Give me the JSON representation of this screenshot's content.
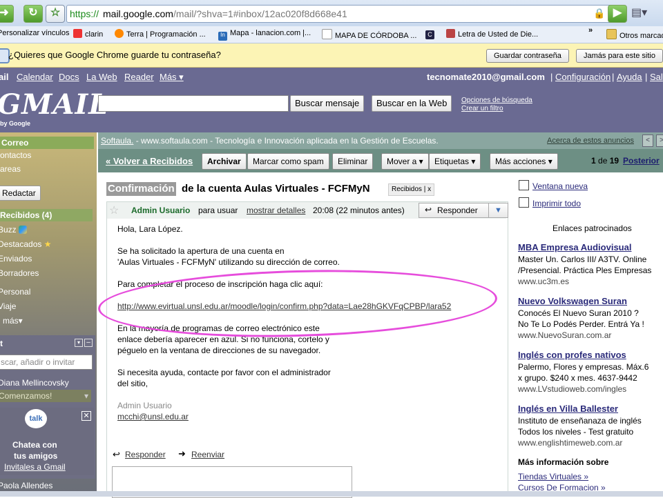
{
  "browser": {
    "url_scheme": "https://",
    "url_host": "mail.google.com",
    "url_path": "/mail/?shva=1#inbox/12ac020f8d668e41",
    "bookmarks": [
      {
        "label": "Personalizar vínculos"
      },
      {
        "label": "clarin"
      },
      {
        "label": "Terra | Programación ..."
      },
      {
        "label": "Mapa - lanacion.com |..."
      },
      {
        "label": "MAPA DE CÓRDOBA ..."
      },
      {
        "label": ""
      },
      {
        "label": "Letra de Usted de Die..."
      },
      {
        "label": "»"
      },
      {
        "label": "Otros marcad"
      }
    ],
    "infobar_text": "¿Quieres que Google Chrome guarde tu contraseña?",
    "infobar_save": "Guardar contraseña",
    "infobar_never": "Jamás para este sitio",
    "colors": {
      "url_green": "#1a8a1a",
      "infobar_bg": "#fcf4b5"
    }
  },
  "gmail": {
    "top_links": [
      "ail",
      "Calendar",
      "Docs",
      "La Web",
      "Reader",
      "Más ▾"
    ],
    "user_email": "tecnomate2010@gmail.com",
    "user_links": [
      "Configuración",
      "Ayuda",
      "Sal"
    ],
    "logo": "GMAIL",
    "logo_sub": "by Google",
    "search_btn": "Buscar mensaje",
    "web_btn": "Buscar en la Web",
    "search_opts_1": "Opciones de búsqueda",
    "search_opts_2": "Crear un filtro"
  },
  "sidebar": {
    "correo": "Correo",
    "contactos": "ontactos",
    "tareas": "areas",
    "redactar": "Redactar",
    "recibidos": "Recibidos (4)",
    "items": [
      "Buzz",
      "Destacados",
      "Enviados",
      "Borradores",
      "Personal",
      "Viaje",
      "más▾"
    ],
    "chat_title": "t",
    "chat_placeholder": "scar, añadir o invitar",
    "contact_1": "Diana Mellincovsky",
    "status": "Comenzamos!",
    "talk_logo": "talk",
    "chatea": "Chatea con",
    "tus_amigos": "tus amigos",
    "invitales": "Invitales a Gmail",
    "contact_2": "Paola Allendes"
  },
  "adbar": {
    "sponsor": "Softaula.",
    "text": " - www.softaula.com - Tecnología e Innovación aplicada en la Gestión de Escuelas.",
    "about": "Acerca de estos anuncios"
  },
  "actions": {
    "back": "« Volver a Recibidos",
    "archive": "Archivar",
    "spam": "Marcar como spam",
    "delete": "Eliminar",
    "move": "Mover a ▾",
    "labels": "Etiquetas ▾",
    "more": "Más acciones ▾",
    "pager_pre": "1",
    "pager_mid": " de ",
    "pager_total": "19",
    "next": "Posterior"
  },
  "message": {
    "subject_hl": "Confirmación",
    "subject_rest": " de la cuenta Aulas Virtuales - FCFMyN",
    "label": "Recibidos",
    "label_x": "x",
    "sender": "Admin Usuario",
    "to": "para usuar",
    "details": "mostrar detalles",
    "time": "20:08 (22 minutos antes)",
    "reply": "Responder",
    "body": [
      "Hola, Lara López.",
      "Se ha solicitado la apertura de una cuenta en",
      "'Aulas Virtuales - FCFMyN' utilizando su dirección de correo.",
      "Para completar el proceso de inscripción haga clic aquí:",
      "http://www.evirtual.unsl.edu.ar/moodle/login/confirm.php?data=Lae28hGKVFqCPBP/lara52",
      "En la mayoría de programas de correo electrónico este",
      "enlace debería aparecer en azul. Si no funciona, cortelo y",
      "péguelo en la ventana de direcciones de su navegador.",
      "Si necesita ayuda, contacte por favor con el administrador",
      "del sitio,",
      "Admin Usuario",
      "mcchi@unsl.edu.ar"
    ],
    "reply_link": "Responder",
    "forward_link": "Reenviar"
  },
  "right": {
    "new_window": "Ventana nueva",
    "print_all": "Imprimir todo",
    "sponsored": "Enlaces patrocinados",
    "ads": [
      {
        "title": "MBA Empresa Audiovisual",
        "lines": [
          "Master Un. Carlos III/ A3TV. Online",
          "/Presencial. Práctica Ples Empresas"
        ],
        "url": "www.uc3m.es"
      },
      {
        "title": "Nuevo Volkswagen Suran",
        "lines": [
          "Conocés El Nuevo Suran 2010 ?",
          "No Te Lo Podés Perder. Entrá Ya !"
        ],
        "url": "www.NuevoSuran.com.ar"
      },
      {
        "title": "Inglés con profes nativos",
        "lines": [
          "Palermo, Flores y empresas. Máx.6",
          "x grupo. $240 x mes. 4637-9442"
        ],
        "url": "www.LVstudioweb.com/ingles"
      },
      {
        "title": "Inglés en Villa Ballester",
        "lines": [
          "Instituto de enseñanaza de inglés",
          "Todos los niveles - Test gratuito"
        ],
        "url": "www.englishtimeweb.com.ar"
      }
    ],
    "more_info": "Más información sobre",
    "more_links": [
      "Tiendas Virtuales »",
      "Cursos De Formacion »"
    ]
  }
}
